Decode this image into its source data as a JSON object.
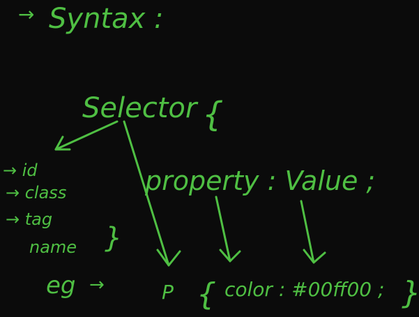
{
  "ink_color": "#4fbf43",
  "background_color": "#0b0b0b",
  "heading": {
    "arrow": "→",
    "text": "Syntax :"
  },
  "rule": {
    "selector": "Selector",
    "open_brace": "{",
    "declaration": "property : Value ;"
  },
  "selector_types": {
    "items": [
      "→ id",
      "→ class",
      "→ tag",
      "name"
    ],
    "brace": "}"
  },
  "example": {
    "label": "eg",
    "arrow": "→",
    "selector": "P",
    "open_brace": "{",
    "declaration": "color : #00ff00 ;",
    "close_brace": "}"
  }
}
